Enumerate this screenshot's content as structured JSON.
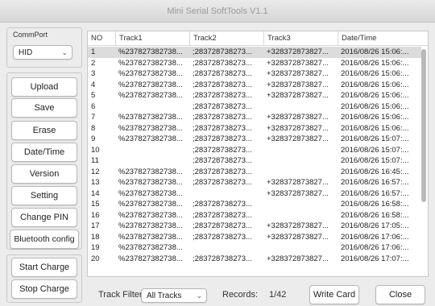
{
  "window": {
    "title": "Mini Serial SoftTools V1.1"
  },
  "sidebar": {
    "group_label": "CommPort",
    "port_select": {
      "value": "HID"
    },
    "buttons": [
      {
        "label": "Upload"
      },
      {
        "label": "Save"
      },
      {
        "label": "Erase"
      },
      {
        "label": "Date/Time"
      },
      {
        "label": "Version"
      },
      {
        "label": "Setting"
      },
      {
        "label": "Change PIN"
      },
      {
        "label": "Bluetooth config"
      },
      {
        "label": "Start Charge"
      },
      {
        "label": "Stop Charge"
      }
    ]
  },
  "table": {
    "columns": [
      "NO",
      "Track1",
      "Track2",
      "Track3",
      "Date/Time"
    ],
    "rows": [
      [
        "1",
        "%237827382738...",
        ";283728738273...",
        "+328372873827...",
        "2016/08/26 15:06:..."
      ],
      [
        "2",
        "%237827382738...",
        ";283728738273...",
        "+328372873827...",
        "2016/08/26 15:06:..."
      ],
      [
        "3",
        "%237827382738...",
        ";283728738273...",
        "+328372873827...",
        "2016/08/26 15:06:..."
      ],
      [
        "4",
        "%237827382738...",
        ";283728738273...",
        "+328372873827...",
        "2016/08/26 15:06:..."
      ],
      [
        "5",
        "%237827382738...",
        ";283728738273...",
        "+328372873827...",
        "2016/08/26 15:06:..."
      ],
      [
        "6",
        "",
        ";283728738273...",
        "",
        "2016/08/26 15:06:..."
      ],
      [
        "7",
        "%237827382738...",
        ";283728738273...",
        "+328372873827...",
        "2016/08/26 15:06:..."
      ],
      [
        "8",
        "%237827382738...",
        ";283728738273...",
        "+328372873827...",
        "2016/08/26 15:06:..."
      ],
      [
        "9",
        "%237827382738...",
        ";283728738273...",
        "+328372873827...",
        "2016/08/26 15:07:..."
      ],
      [
        "10",
        "",
        ";283728738273...",
        "",
        "2016/08/26 15:07:..."
      ],
      [
        "11",
        "",
        ";283728738273...",
        "",
        "2016/08/26 15:07:..."
      ],
      [
        "12",
        "%237827382738...",
        ";283728738273...",
        "",
        "2016/08/26 16:45:..."
      ],
      [
        "13",
        "%237827382738...",
        ";283728738273...",
        "+328372873827...",
        "2016/08/26 16:57:..."
      ],
      [
        "14",
        "%237827382738...",
        "",
        "+328372873827...",
        "2016/08/26 16:57:..."
      ],
      [
        "15",
        "%237827382738...",
        ";283728738273...",
        "",
        "2016/08/26 16:58:..."
      ],
      [
        "16",
        "%237827382738...",
        ";283728738273...",
        "",
        "2016/08/26 16:58:..."
      ],
      [
        "17",
        "%237827382738...",
        ";283728738273...",
        "+328372873827...",
        "2016/08/26 17:05:..."
      ],
      [
        "18",
        "%237827382738...",
        ";283728738273...",
        "+328372873827...",
        "2016/08/26 17:06:..."
      ],
      [
        "19",
        "%237827382738...",
        "",
        "",
        "2016/08/26 17:06:..."
      ],
      [
        "20",
        "%237827382738...",
        ";283728738273...",
        "+328372873827...",
        "2016/08/26 17:07:..."
      ]
    ],
    "selected_row": 0
  },
  "footer": {
    "filter_label": "Track Filter",
    "filter_select": {
      "value": "All Tracks"
    },
    "records_label": "Records:",
    "records_value": "1/42",
    "write_card_label": "Write Card",
    "close_label": "Close"
  },
  "colors": {
    "selected_row": "#dcdcdc",
    "window_bg": "#ececec"
  }
}
